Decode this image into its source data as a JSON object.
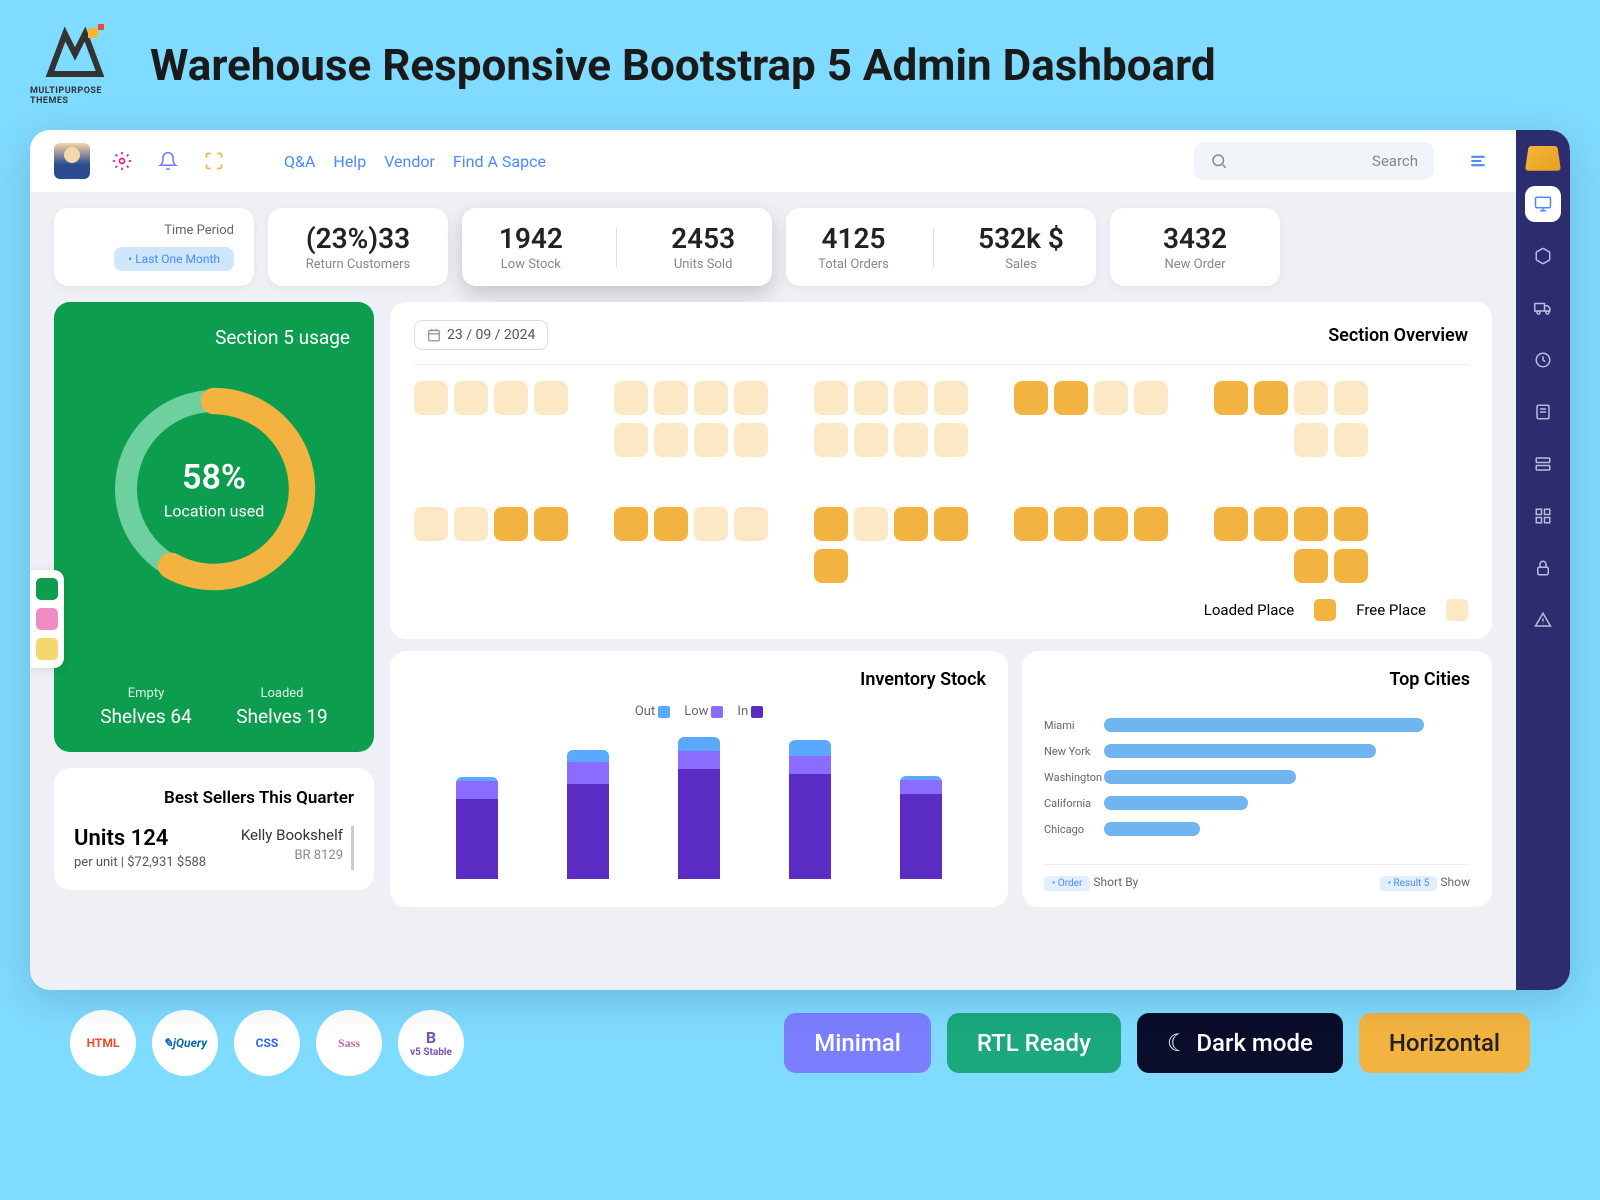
{
  "pageTitle": "Warehouse Responsive Bootstrap 5 Admin Dashboard",
  "brandLogoText": "MULTIPURPOSE THEMES",
  "nav": {
    "qa": "Q&A",
    "help": "Help",
    "vendor": "Vendor",
    "findSpace": "Find A Sapce"
  },
  "search": {
    "placeholder": "Search"
  },
  "timePeriod": {
    "label": "Time Period",
    "badge": "• Last One Month"
  },
  "stats": {
    "returnCustomers": {
      "val": "(23%)33",
      "label": "Return Customers"
    },
    "lowStock": {
      "val": "1942",
      "label": "Low Stock"
    },
    "unitsSold": {
      "val": "2453",
      "label": "Units Sold"
    },
    "totalOrders": {
      "val": "4125",
      "label": "Total Orders"
    },
    "sales": {
      "val": "532k $",
      "label": "Sales"
    },
    "newOrder": {
      "val": "3432",
      "label": "New Order"
    }
  },
  "usage": {
    "title": "Section 5 usage",
    "percent": "58%",
    "percentLabel": "Location used",
    "emptyLabel": "Empty",
    "emptyVal": "Shelves 64",
    "loadedLabel": "Loaded",
    "loadedVal": "Shelves 19"
  },
  "bestSellers": {
    "title": "Best Sellers This Quarter",
    "units": "Units 124",
    "price": "per unit | $72,931 $588",
    "product": "Kelly Bookshelf",
    "code": "BR 8129"
  },
  "overview": {
    "date": "23 / 09 / 2024",
    "title": "Section Overview",
    "legendLoaded": "Loaded Place",
    "legendFree": "Free Place",
    "grid": [
      [
        "f",
        "f",
        "f",
        "f",
        "e",
        "f",
        "f",
        "f",
        "f",
        "e",
        "f",
        "f",
        "f",
        "f",
        "e",
        "l",
        "l",
        "f",
        "f",
        "e",
        "l",
        "l",
        "f",
        "f"
      ],
      [
        "e",
        "e",
        "e",
        "e",
        "e",
        "f",
        "f",
        "f",
        "f",
        "e",
        "f",
        "f",
        "f",
        "f",
        "e",
        "e",
        "e",
        "e",
        "e",
        "e",
        "e",
        "e",
        "f",
        "f"
      ],
      [
        "e",
        "e",
        "e",
        "e",
        "e",
        "e",
        "e",
        "e",
        "e",
        "e",
        "e",
        "e",
        "e",
        "e",
        "e",
        "e",
        "e",
        "e",
        "e",
        "e",
        "e",
        "e",
        "e",
        "e"
      ],
      [
        "f",
        "f",
        "l",
        "l",
        "e",
        "l",
        "l",
        "f",
        "f",
        "e",
        "l",
        "f",
        "l",
        "l",
        "e",
        "l",
        "l",
        "l",
        "l",
        "e",
        "l",
        "l",
        "l",
        "l"
      ],
      [
        "e",
        "e",
        "e",
        "e",
        "e",
        "e",
        "e",
        "e",
        "e",
        "e",
        "l",
        "e",
        "e",
        "e",
        "e",
        "e",
        "e",
        "e",
        "e",
        "e",
        "e",
        "e",
        "l",
        "l"
      ]
    ]
  },
  "inventory": {
    "title": "Inventory Stock",
    "legend": {
      "out": "Out",
      "low": "Low",
      "in": "In"
    }
  },
  "topCities": {
    "title": "Top Cities",
    "shortBy": "Short By",
    "shortByBadge": "• Order",
    "show": "Show",
    "showBadge": "• Result 5"
  },
  "footer": {
    "tech": {
      "html": "HTML",
      "jquery": "jQuery",
      "css": "CSS",
      "sass": "Sass",
      "bootstrap": "v5 Stable"
    },
    "pills": {
      "minimal": "Minimal",
      "rtl": "RTL Ready",
      "dark": "Dark mode",
      "horiz": "Horizontal"
    }
  },
  "chart_data": [
    {
      "type": "bar",
      "title": "Inventory Stock",
      "series": [
        {
          "name": "In",
          "values": [
            80,
            95,
            110,
            105,
            85
          ],
          "color": "#5b2cc4"
        },
        {
          "name": "Low",
          "values": [
            18,
            22,
            18,
            18,
            14
          ],
          "color": "#8a6cff"
        },
        {
          "name": "Out",
          "values": [
            4,
            12,
            14,
            16,
            4
          ],
          "color": "#5aa9ff"
        }
      ],
      "categories": [
        "",
        "",
        "",
        "",
        ""
      ],
      "ylim": [
        0,
        150
      ]
    },
    {
      "type": "bar",
      "title": "Top Cities",
      "orientation": "horizontal",
      "categories": [
        "Miami",
        "New York",
        "Washington",
        "California",
        "Chicago"
      ],
      "values": [
        100,
        85,
        60,
        45,
        30
      ],
      "color": "#6fb5f0"
    },
    {
      "type": "pie",
      "title": "Section 5 usage — Location used",
      "values": [
        58,
        42
      ],
      "labels": [
        "Used",
        "Free"
      ],
      "colors": [
        "#f3b340",
        "#6fd09f"
      ]
    }
  ]
}
